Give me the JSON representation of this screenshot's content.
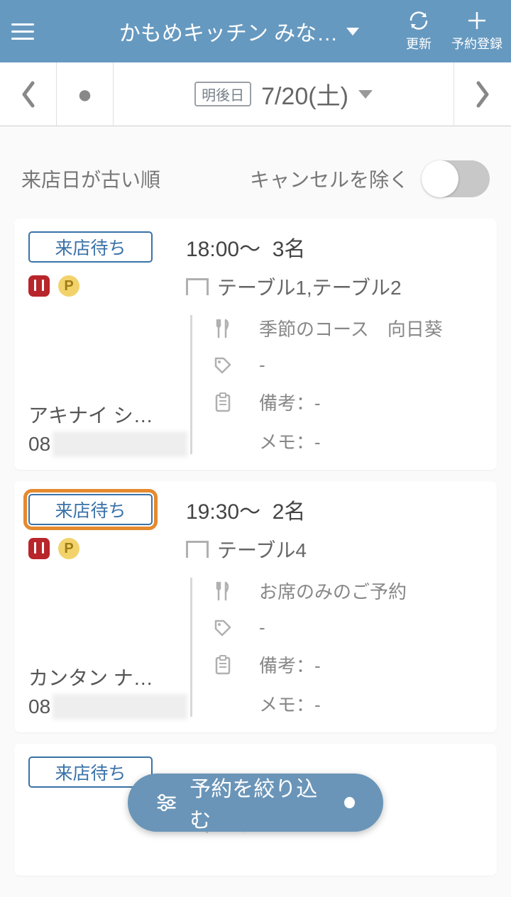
{
  "header": {
    "title": "かもめキッチン みな…",
    "refresh_label": "更新",
    "register_label": "予約登録"
  },
  "datebar": {
    "tag": "明後日",
    "date": "7/20(土)"
  },
  "controls": {
    "sort_label": "来店日が古い順",
    "exclude_cancel_label": "キャンセルを除く"
  },
  "icons": {
    "p": "P"
  },
  "reservations": [
    {
      "status": "来店待ち",
      "highlighted": false,
      "time": "18:00～",
      "party": "3名",
      "tables": "テーブル1,テーブル2",
      "course": "季節のコース　向日葵",
      "tag": "-",
      "note": "備考：-",
      "memo": "メモ：-",
      "customer": "アキナイ シ…",
      "phone": "08"
    },
    {
      "status": "来店待ち",
      "highlighted": true,
      "time": "19:30～",
      "party": "2名",
      "tables": "テーブル4",
      "course": "お席のみのご予約",
      "tag": "-",
      "note": "備考：-",
      "memo": "メモ：-",
      "customer": "カンタン ナ…",
      "phone": "08"
    },
    {
      "status": "来店待ち",
      "highlighted": false,
      "time": "",
      "party": "",
      "tables": "",
      "course": "",
      "tag": "",
      "note": "",
      "memo": "",
      "customer": "",
      "phone": ""
    }
  ],
  "fab": {
    "label": "予約を絞り込む"
  }
}
